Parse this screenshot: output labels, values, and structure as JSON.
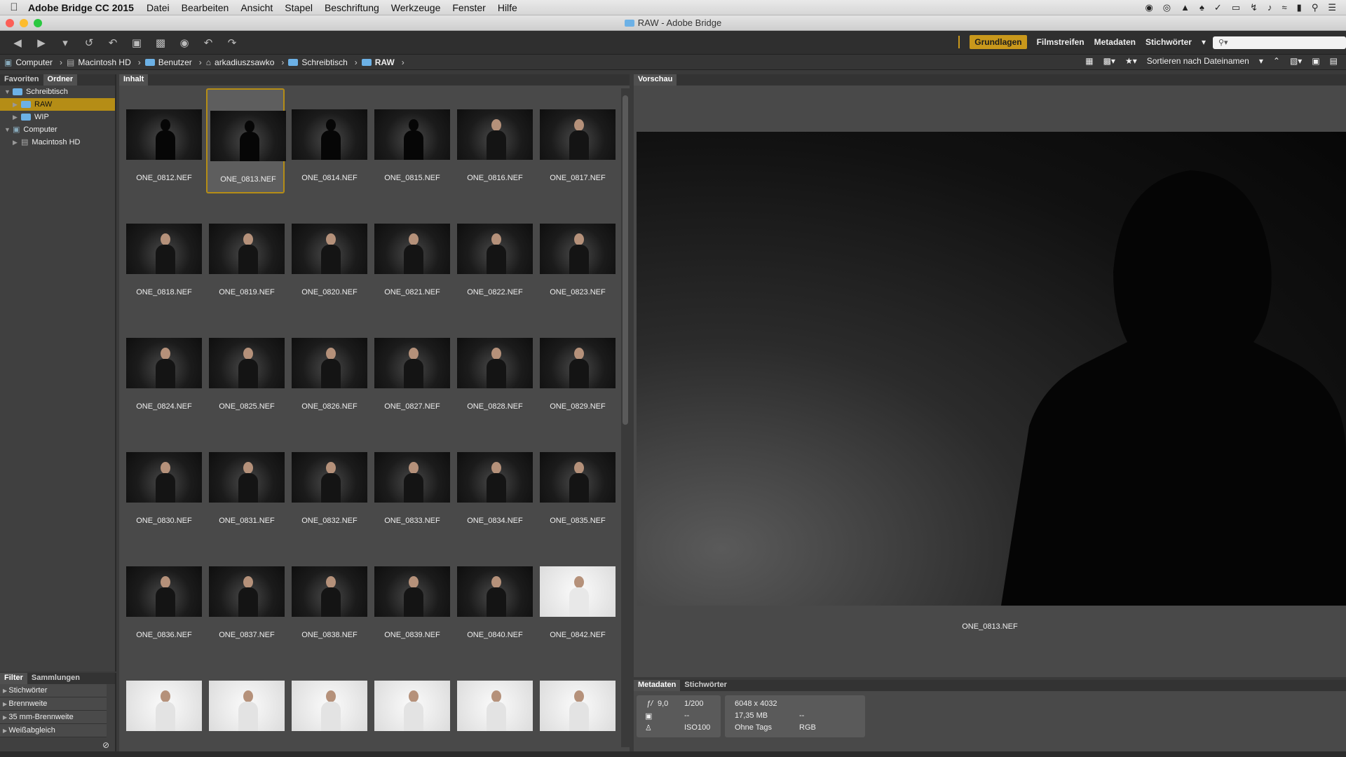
{
  "menubar": {
    "app_name": "Adobe Bridge CC 2015",
    "items": [
      "Datei",
      "Bearbeiten",
      "Ansicht",
      "Stapel",
      "Beschriftung",
      "Werkzeuge",
      "Fenster",
      "Hilfe"
    ]
  },
  "window": {
    "title": "RAW - Adobe Bridge"
  },
  "workspaces": {
    "active": "Grundlagen",
    "items": [
      "Filmstreifen",
      "Metadaten",
      "Stichwörter"
    ]
  },
  "path": {
    "crumbs": [
      "Computer",
      "Macintosh HD",
      "Benutzer",
      "arkadiuszsawko",
      "Schreibtisch",
      "RAW"
    ],
    "sort_label": "Sortieren nach Dateinamen"
  },
  "favorites_panel": {
    "tabs": [
      "Favoriten",
      "Ordner"
    ],
    "tree": [
      {
        "label": "Schreibtisch",
        "depth": 0,
        "expanded": true,
        "selected": false
      },
      {
        "label": "RAW",
        "depth": 1,
        "expanded": false,
        "selected": true
      },
      {
        "label": "WIP",
        "depth": 1,
        "expanded": false,
        "selected": false
      },
      {
        "label": "Computer",
        "depth": 0,
        "expanded": true,
        "selected": false
      },
      {
        "label": "Macintosh HD",
        "depth": 1,
        "expanded": false,
        "selected": false
      }
    ]
  },
  "filter_panel": {
    "tabs": [
      "Filter",
      "Sammlungen"
    ],
    "items": [
      "Stichwörter",
      "Brennweite",
      "35 mm-Brennweite",
      "Weißabgleich"
    ]
  },
  "content_panel": {
    "tab": "Inhalt",
    "thumbnails": [
      "ONE_0812.NEF",
      "ONE_0813.NEF",
      "ONE_0814.NEF",
      "ONE_0815.NEF",
      "ONE_0816.NEF",
      "ONE_0817.NEF",
      "ONE_0818.NEF",
      "ONE_0819.NEF",
      "ONE_0820.NEF",
      "ONE_0821.NEF",
      "ONE_0822.NEF",
      "ONE_0823.NEF",
      "ONE_0824.NEF",
      "ONE_0825.NEF",
      "ONE_0826.NEF",
      "ONE_0827.NEF",
      "ONE_0828.NEF",
      "ONE_0829.NEF",
      "ONE_0830.NEF",
      "ONE_0831.NEF",
      "ONE_0832.NEF",
      "ONE_0833.NEF",
      "ONE_0834.NEF",
      "ONE_0835.NEF",
      "ONE_0836.NEF",
      "ONE_0837.NEF",
      "ONE_0838.NEF",
      "ONE_0839.NEF",
      "ONE_0840.NEF",
      "ONE_0842.NEF"
    ],
    "selected": "ONE_0813.NEF"
  },
  "preview_panel": {
    "tab": "Vorschau",
    "filename": "ONE_0813.NEF"
  },
  "metadata_panel": {
    "tabs": [
      "Metadaten",
      "Stichwörter"
    ],
    "aperture": "9,0",
    "shutter": "1/200",
    "dash1": "--",
    "iso": "ISO100",
    "dimensions": "6048 x 4032",
    "filesize": "17,35 MB",
    "dash2": "--",
    "tags": "Ohne Tags",
    "colormode": "RGB"
  },
  "colors": {
    "accent": "#c9981b",
    "selection": "#b58d16"
  }
}
